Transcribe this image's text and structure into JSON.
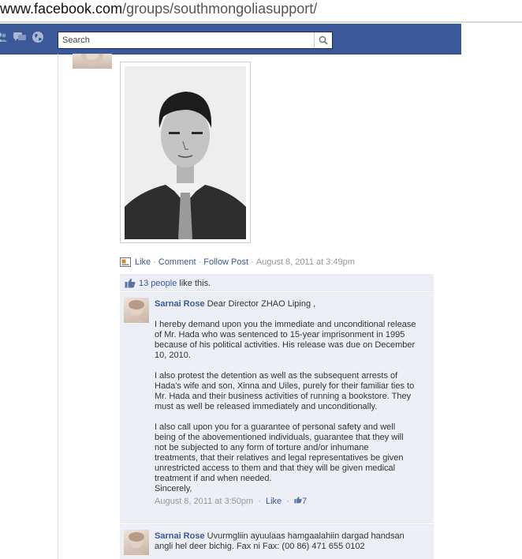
{
  "browser": {
    "url_domain": "www.facebook.com",
    "url_path": "/groups/southmongoliasupport/"
  },
  "header": {
    "search_placeholder": "Search"
  },
  "post": {
    "actions": {
      "like": "Like",
      "comment": "Comment",
      "follow": "Follow Post",
      "timestamp": "August 8, 2011 at 3:49pm"
    },
    "likes": {
      "people": "13 people",
      "suffix": "like this."
    }
  },
  "comments": [
    {
      "author": "Sarnai Rose",
      "opening": "Dear Director ZHAO Liping ,",
      "paragraphs": [
        [
          "I hereby demand upon you the immediate and unconditional release",
          "of Mr. Hada who was sentenced to 15-year imprisonment in 1995",
          "because of his political activities. His release was due on December",
          "10, 2010."
        ],
        [
          "I also protest the detention as well as the subsequent arrests of",
          "Hada's wife and son, Xinna and Uiles, purely for their familiar ties to",
          "Mr. Hada and their business activities of running a bookstore. They",
          "must as well be released immediately and unconditionally."
        ],
        [
          "I also call upon you for a guarantee of personal safety and well",
          "being of the abovementioned individuals, guarantee that they will",
          "not be subjected to any form of torture and/or inhumane",
          "treatments, that their relatives and legal representatives be given",
          "unrestricted access to them and that they will be given medical",
          "treatment if and when needed.",
          "Sincerely,"
        ]
      ],
      "timestamp": "August 8, 2011 at 3:50pm",
      "like_label": "Like",
      "like_count": "7"
    },
    {
      "author": "Sarnai Rose",
      "line1": "Uvurmgliin ayuulaas hamgaalahiin dargad handsan",
      "line2": "angli hel deer bichig. Fax ni Fax: (00 86) 471 655 0102"
    }
  ]
}
